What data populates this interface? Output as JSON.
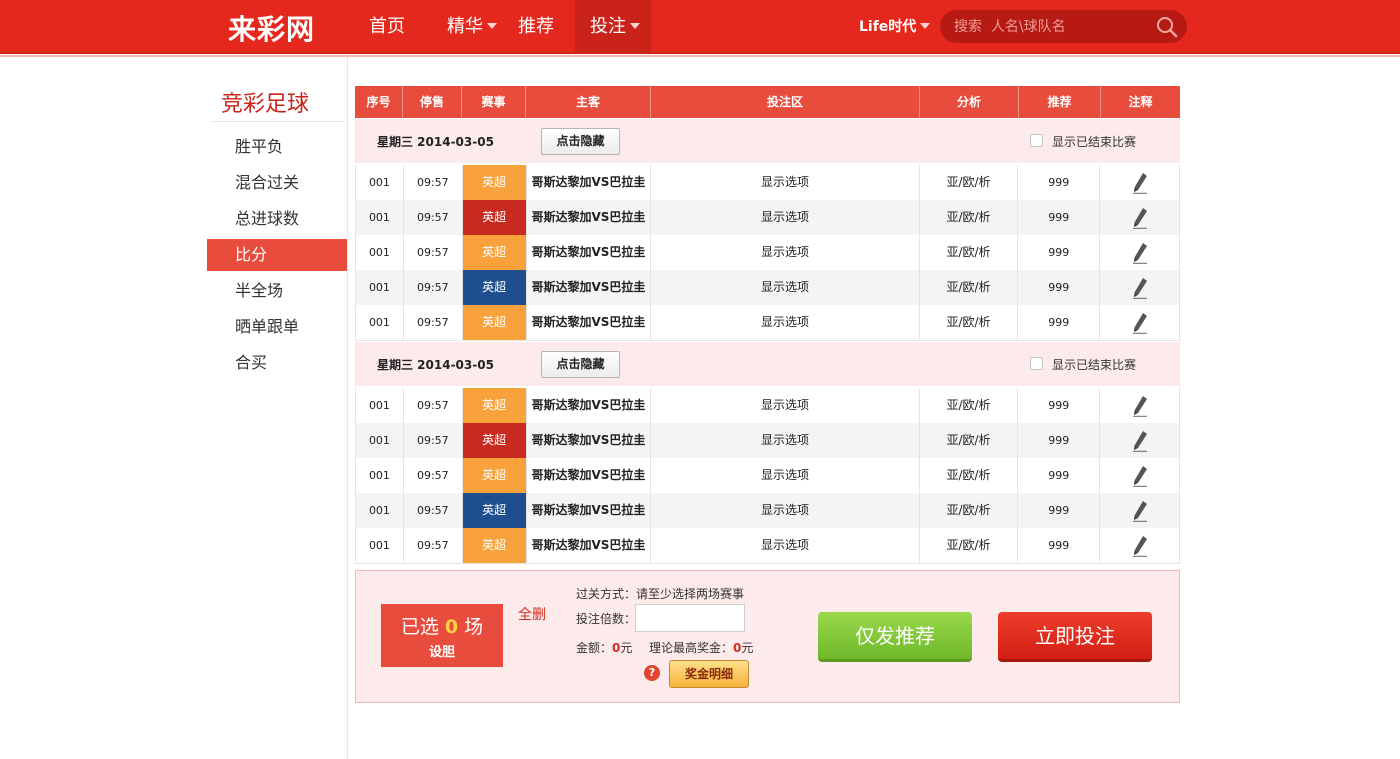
{
  "header": {
    "logo": "来彩网",
    "nav": [
      {
        "label": "首页",
        "caret": false,
        "active": false
      },
      {
        "label": "精华",
        "caret": true,
        "active": false
      },
      {
        "label": "推荐",
        "caret": false,
        "active": false
      },
      {
        "label": "投注",
        "caret": true,
        "active": true
      }
    ],
    "life": "Life时代",
    "search_placeholder": "搜索  人名\\球队名"
  },
  "sidebar": {
    "title": "竞彩足球",
    "items": [
      "胜平负",
      "混合过关",
      "总进球数",
      "比分",
      "半全场",
      "晒单跟单",
      "合买"
    ],
    "active_index": 3
  },
  "table": {
    "columns": [
      "序号",
      "停售",
      "赛事",
      "主客",
      "投注区",
      "分析",
      "推荐",
      "注释"
    ],
    "groups": [
      {
        "date_label": "星期三    2014-03-05",
        "hide_button": "点击隐藏",
        "show_finished": "显示已结束比赛",
        "rows": [
          {
            "no": "001",
            "time": "09:57",
            "league": "英超",
            "league_color": "#f9a23c",
            "match": "哥斯达黎加VS巴拉圭",
            "options": "显示选项",
            "analysis": "亚/欧/析",
            "recommend": "999"
          },
          {
            "no": "001",
            "time": "09:57",
            "league": "英超",
            "league_color": "#c92a1f",
            "match": "哥斯达黎加VS巴拉圭",
            "options": "显示选项",
            "analysis": "亚/欧/析",
            "recommend": "999"
          },
          {
            "no": "001",
            "time": "09:57",
            "league": "英超",
            "league_color": "#f9a23c",
            "match": "哥斯达黎加VS巴拉圭",
            "options": "显示选项",
            "analysis": "亚/欧/析",
            "recommend": "999"
          },
          {
            "no": "001",
            "time": "09:57",
            "league": "英超",
            "league_color": "#1f4e8f",
            "match": "哥斯达黎加VS巴拉圭",
            "options": "显示选项",
            "analysis": "亚/欧/析",
            "recommend": "999"
          },
          {
            "no": "001",
            "time": "09:57",
            "league": "英超",
            "league_color": "#f9a23c",
            "match": "哥斯达黎加VS巴拉圭",
            "options": "显示选项",
            "analysis": "亚/欧/析",
            "recommend": "999"
          }
        ]
      },
      {
        "date_label": "星期三    2014-03-05",
        "hide_button": "点击隐藏",
        "show_finished": "显示已结束比赛",
        "rows": [
          {
            "no": "001",
            "time": "09:57",
            "league": "英超",
            "league_color": "#f9a23c",
            "match": "哥斯达黎加VS巴拉圭",
            "options": "显示选项",
            "analysis": "亚/欧/析",
            "recommend": "999"
          },
          {
            "no": "001",
            "time": "09:57",
            "league": "英超",
            "league_color": "#c92a1f",
            "match": "哥斯达黎加VS巴拉圭",
            "options": "显示选项",
            "analysis": "亚/欧/析",
            "recommend": "999"
          },
          {
            "no": "001",
            "time": "09:57",
            "league": "英超",
            "league_color": "#f9a23c",
            "match": "哥斯达黎加VS巴拉圭",
            "options": "显示选项",
            "analysis": "亚/欧/析",
            "recommend": "999"
          },
          {
            "no": "001",
            "time": "09:57",
            "league": "英超",
            "league_color": "#1f4e8f",
            "match": "哥斯达黎加VS巴拉圭",
            "options": "显示选项",
            "analysis": "亚/欧/析",
            "recommend": "999"
          },
          {
            "no": "001",
            "time": "09:57",
            "league": "英超",
            "league_color": "#f9a23c",
            "match": "哥斯达黎加VS巴拉圭",
            "options": "显示选项",
            "analysis": "亚/欧/析",
            "recommend": "999"
          }
        ]
      }
    ]
  },
  "bet_panel": {
    "selected_prefix": "已选",
    "selected_count": "0",
    "selected_suffix": "场",
    "set_banker": "设胆",
    "clear_all": "全删",
    "mode_text": "过关方式：请至少选择两场赛事",
    "multiplier_label": "投注倍数：",
    "multiplier_value": "",
    "amount_label": "金额：",
    "amount_value": "0",
    "yuan": "元",
    "max_prize_label": "理论最高奖金：",
    "max_prize_value": "0",
    "help": "?",
    "detail_button": "奖金明细",
    "recommend_button": "仅发推荐",
    "bet_button": "立即投注"
  },
  "colors": {
    "brand_red": "#e4281d",
    "table_head": "#e84c3d",
    "league_orange": "#f9a23c",
    "league_red": "#c92a1f",
    "league_blue": "#1f4e8f"
  }
}
